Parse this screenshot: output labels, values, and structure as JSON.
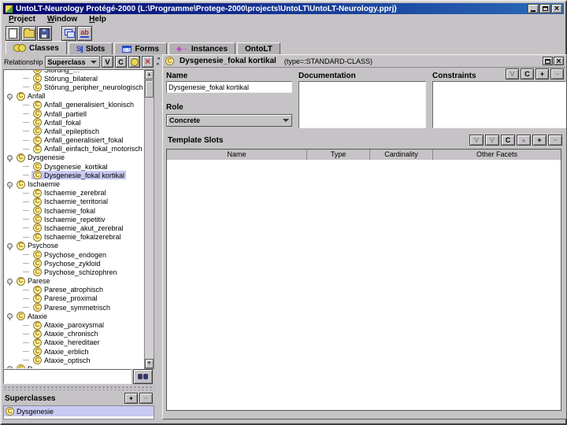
{
  "colors": {
    "title_bar": "#020270",
    "selection_highlight": "#c9c9f2",
    "class_icon_fill": "#f6f0a0",
    "accent_blue": "#2846c8"
  },
  "window": {
    "title": "UntoLT-Neurology Protégé-2000   (L:\\Programme\\Protege-2000\\projects\\UntoLT\\UntoLT-Neurology.pprj)",
    "controls": [
      {
        "name": "minimize-button",
        "icon": "minimize-icon"
      },
      {
        "name": "restore-button",
        "icon": "restore-icon"
      },
      {
        "name": "close-button",
        "icon": "close-icon"
      }
    ]
  },
  "menu": {
    "items": [
      "Project",
      "Window",
      "Help"
    ]
  },
  "toolbar": {
    "buttons": [
      {
        "name": "new-project-button",
        "icon": "new-file-icon"
      },
      {
        "name": "open-project-button",
        "icon": "open-folder-icon"
      },
      {
        "name": "save-project-button",
        "icon": "save-icon"
      },
      {
        "name": "cascade-windows-button",
        "icon": "cascade-icon",
        "gap": true
      },
      {
        "name": "text-tool-button",
        "icon": "text-tool-icon"
      }
    ]
  },
  "tabs": [
    {
      "label": "Classes",
      "icon": "classes-icon",
      "selected": true
    },
    {
      "label": "Slots",
      "icon": "slots-icon",
      "selected": false
    },
    {
      "label": "Forms",
      "icon": "forms-icon",
      "selected": false
    },
    {
      "label": "Instances",
      "icon": "instances-icon",
      "selected": false
    },
    {
      "label": "OntoLT",
      "icon": null,
      "selected": false
    }
  ],
  "left_panel": {
    "header": {
      "label": "Relationship",
      "dropdown_value": "Superclass",
      "buttons": [
        {
          "name": "view-class-button",
          "label": "V",
          "enabled": true
        },
        {
          "name": "create-class-button",
          "label": "C",
          "enabled": true
        },
        {
          "name": "create-subclass-button",
          "icon": "subclass-icon",
          "enabled": true
        },
        {
          "name": "delete-class-button",
          "icon": "delete-x-icon",
          "enabled": true
        }
      ]
    },
    "tree": {
      "rows": [
        {
          "label": "Störung_…",
          "level": 2,
          "kind": "leaf"
        },
        {
          "label": "Störung_bilateral",
          "level": 2,
          "kind": "leaf"
        },
        {
          "label": "Störung_peripher_neurologisch",
          "level": 2,
          "kind": "leaf"
        },
        {
          "label": "Anfall",
          "level": 1,
          "kind": "parent"
        },
        {
          "label": "Anfall_generalisiert_klonisch",
          "level": 2,
          "kind": "leaf"
        },
        {
          "label": "Anfall_partiell",
          "level": 2,
          "kind": "leaf"
        },
        {
          "label": "Anfall_fokal",
          "level": 2,
          "kind": "leaf"
        },
        {
          "label": "Anfall_epileptisch",
          "level": 2,
          "kind": "leaf"
        },
        {
          "label": "Anfall_generalisiert_fokal",
          "level": 2,
          "kind": "leaf"
        },
        {
          "label": "Anfall_einfach_fokal_motorisch",
          "level": 2,
          "kind": "leaf"
        },
        {
          "label": "Dysgenesie",
          "level": 1,
          "kind": "parent"
        },
        {
          "label": "Dysgenesie_kortikal",
          "level": 2,
          "kind": "leaf"
        },
        {
          "label": "Dysgenesie_fokal kortikal",
          "level": 2,
          "kind": "leaf",
          "selected": true
        },
        {
          "label": "Ischaemie",
          "level": 1,
          "kind": "parent"
        },
        {
          "label": "Ischaemie_zerebral",
          "level": 2,
          "kind": "leaf"
        },
        {
          "label": "Ischaemie_territorial",
          "level": 2,
          "kind": "leaf"
        },
        {
          "label": "Ischaemie_fokal",
          "level": 2,
          "kind": "leaf"
        },
        {
          "label": "Ischaemie_repetitiv",
          "level": 2,
          "kind": "leaf"
        },
        {
          "label": "Ischaemie_akut_zerebral",
          "level": 2,
          "kind": "leaf"
        },
        {
          "label": "Ischaemie_fokalzerebral",
          "level": 2,
          "kind": "leaf"
        },
        {
          "label": "Psychose",
          "level": 1,
          "kind": "parent"
        },
        {
          "label": "Psychose_endogen",
          "level": 2,
          "kind": "leaf"
        },
        {
          "label": "Psychose_zykloid",
          "level": 2,
          "kind": "leaf"
        },
        {
          "label": "Psychose_schizophren",
          "level": 2,
          "kind": "leaf"
        },
        {
          "label": "Parese",
          "level": 1,
          "kind": "parent"
        },
        {
          "label": "Parese_atrophisch",
          "level": 2,
          "kind": "leaf"
        },
        {
          "label": "Parese_proximal",
          "level": 2,
          "kind": "leaf"
        },
        {
          "label": "Parese_symmetrisch",
          "level": 2,
          "kind": "leaf"
        },
        {
          "label": "Ataxie",
          "level": 1,
          "kind": "parent"
        },
        {
          "label": "Ataxie_paroxysmal",
          "level": 2,
          "kind": "leaf"
        },
        {
          "label": "Ataxie_chronisch",
          "level": 2,
          "kind": "leaf"
        },
        {
          "label": "Ataxie_hereditaer",
          "level": 2,
          "kind": "leaf"
        },
        {
          "label": "Ataxie_erblich",
          "level": 2,
          "kind": "leaf"
        },
        {
          "label": "Ataxie_optisch",
          "level": 2,
          "kind": "leaf"
        },
        {
          "label": "D…",
          "level": 1,
          "kind": "parent"
        }
      ]
    },
    "search": {
      "value": ""
    },
    "superclasses": {
      "title": "Superclasses",
      "buttons": [
        {
          "name": "add-superclass-button",
          "label": "+",
          "enabled": true
        },
        {
          "name": "remove-superclass-button",
          "label": "−",
          "enabled": false
        }
      ],
      "items": [
        {
          "label": "Dysgenesie",
          "selected": true
        }
      ]
    }
  },
  "right_panel": {
    "header": {
      "title": "Dysgenesie_fokal kortikal",
      "type_text": "(type=:STANDARD-CLASS)"
    },
    "form": {
      "name_label": "Name",
      "name_value": "Dysgenesie_fokal kortikal",
      "documentation_label": "Documentation",
      "documentation_value": "",
      "constraints_label": "Constraints",
      "constraints_buttons": [
        {
          "name": "view-constraint-button",
          "label": "V",
          "enabled": false
        },
        {
          "name": "create-constraint-button",
          "label": "C",
          "enabled": true
        },
        {
          "name": "add-constraint-button",
          "label": "+",
          "enabled": true
        },
        {
          "name": "remove-constraint-button",
          "label": "−",
          "enabled": false
        }
      ],
      "role_label": "Role",
      "role_value": "Concrete"
    },
    "template_slots": {
      "title": "Template Slots",
      "buttons": [
        {
          "name": "view-slot-button",
          "label": "V",
          "enabled": false
        },
        {
          "name": "view-slot-at-class-button",
          "label": "V",
          "enabled": false
        },
        {
          "name": "create-slot-button",
          "label": "C",
          "enabled": true
        },
        {
          "name": "detach-slot-button",
          "icon": "slot-box-icon",
          "enabled": false
        },
        {
          "name": "add-slot-button",
          "label": "+",
          "enabled": true
        },
        {
          "name": "remove-slot-button",
          "label": "−",
          "enabled": false
        }
      ],
      "columns": [
        "Name",
        "Type",
        "Cardinality",
        "Other Facets"
      ],
      "rows": []
    }
  }
}
